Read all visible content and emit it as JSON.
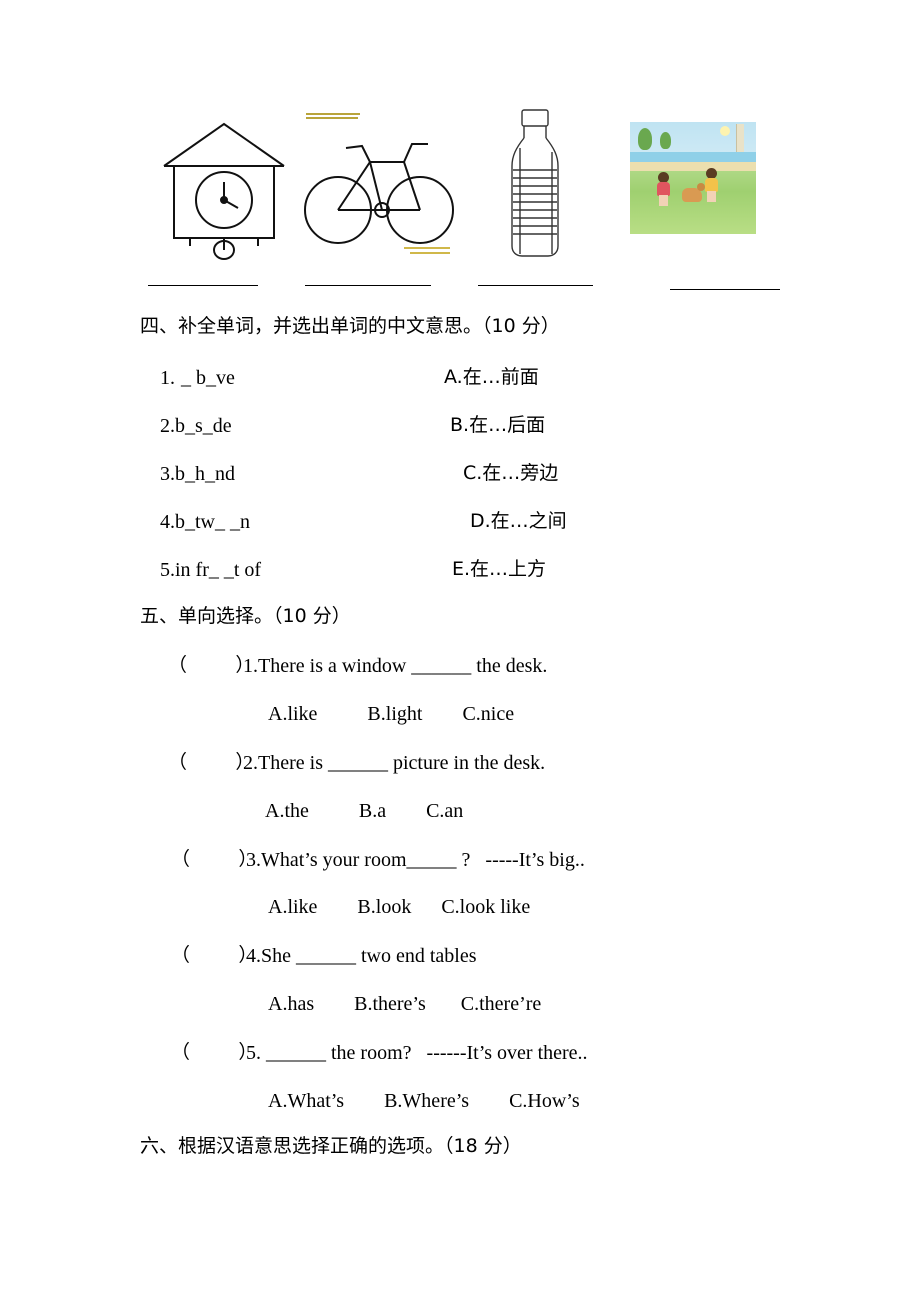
{
  "pictures": {
    "items": [
      {
        "name": "clock-house-drawing",
        "label": ""
      },
      {
        "name": "bicycle-drawing",
        "label": ""
      },
      {
        "name": "water-bottle-drawing",
        "label": ""
      },
      {
        "name": "beach-children-photo",
        "label": ""
      }
    ]
  },
  "section4": {
    "heading": "四、补全单词，并选出单词的中文意思。（10 分）",
    "items": [
      {
        "num": "1.",
        "word": "_ b_ve",
        "choice": "A.在…前面"
      },
      {
        "num": "2.",
        "word": "b_s_de",
        "choice": "B.在…后面"
      },
      {
        "num": "3.",
        "word": "b_h_nd",
        "choice": "C.在…旁边"
      },
      {
        "num": "4.",
        "word": "b_tw_ _n",
        "choice": "D.在…之间"
      },
      {
        "num": "5.",
        "word": "in fr_ _t of",
        "choice": "E.在…上方"
      }
    ]
  },
  "section5": {
    "heading": "五、单向选择。（10 分）",
    "bracket": "（        ）",
    "questions": [
      {
        "stem": "1.There is a window ______ the desk.",
        "options": "A.like          B.light        C.nice"
      },
      {
        "stem": "2.There is ______ picture in the desk.",
        "options": "A.the          B.a        C.an"
      },
      {
        "stem": "3.What’s your room_____ ?   -----It’s big..",
        "options": "A.like        B.look      C.look like"
      },
      {
        "stem": "4.She ______ two end tables",
        "options": "A.has        B.there’s       C.there’re"
      },
      {
        "stem": "5. ______ the room?   ------It’s over there..",
        "options": "A.What’s        B.Where’s        C.How’s"
      }
    ]
  },
  "section6": {
    "heading": "六、根据汉语意思选择正确的选项。（18 分）"
  }
}
